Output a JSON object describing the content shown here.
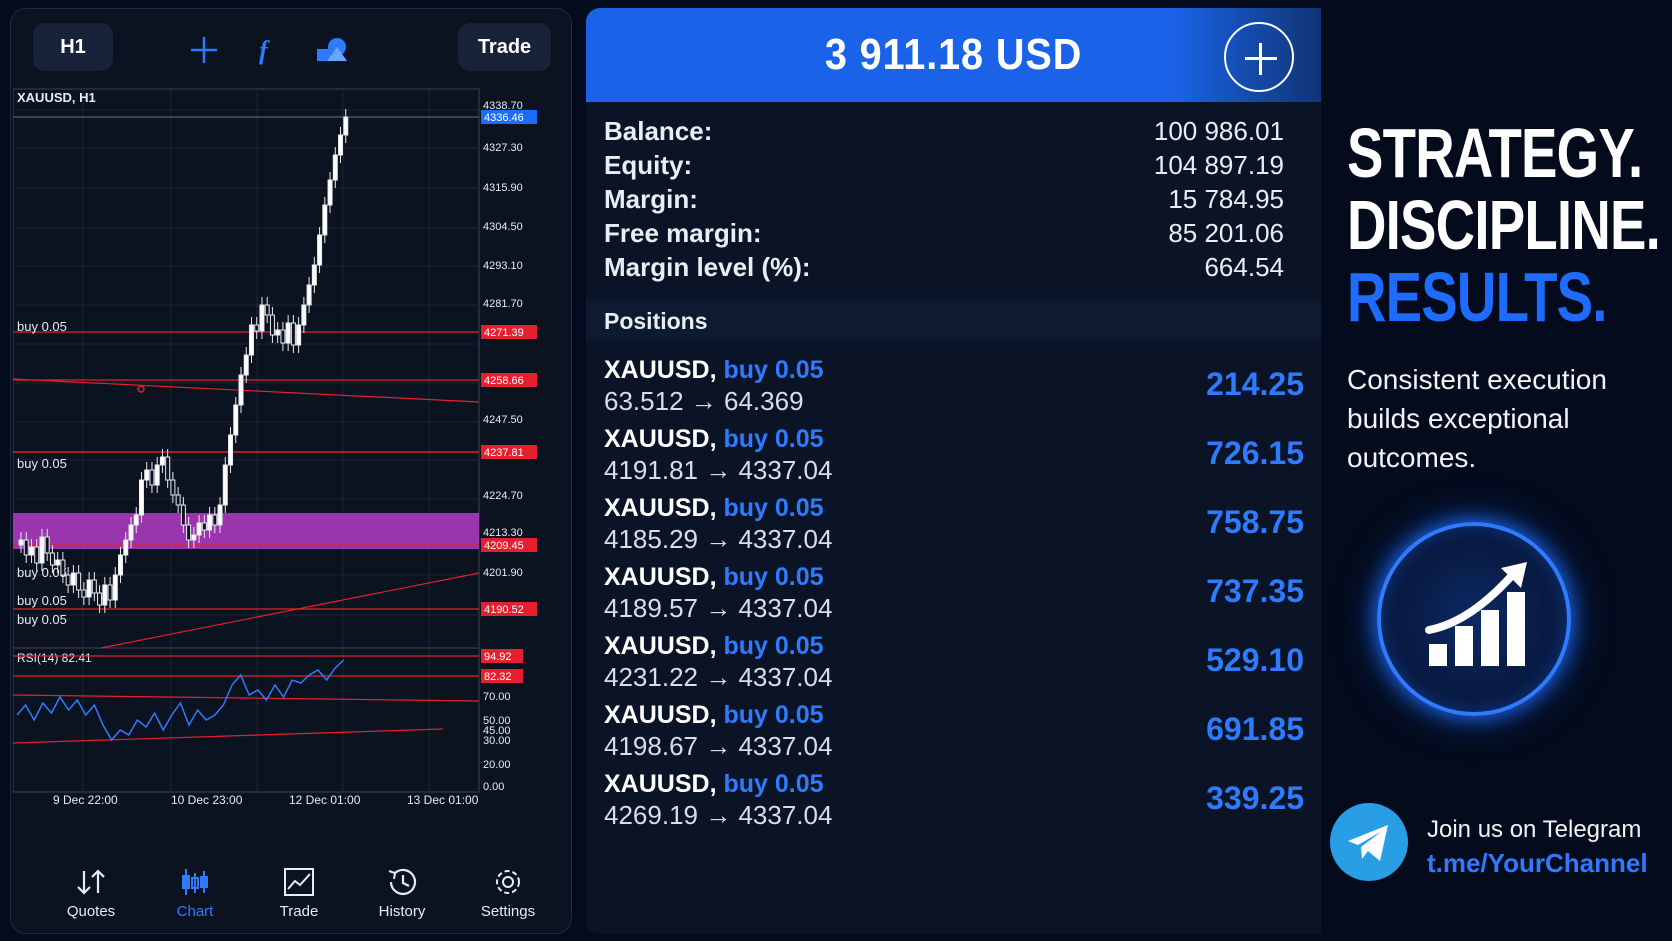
{
  "toolbar": {
    "timeframe": "H1",
    "trade_label": "Trade",
    "icons": [
      "crosshair-icon",
      "function-icon",
      "objects-icon"
    ]
  },
  "chart": {
    "symbol_label": "XAUUSD, H1",
    "price_ticks": [
      "4338.70",
      "4327.30",
      "4315.90",
      "4304.50",
      "4293.10",
      "4281.70",
      "4247.50",
      "4224.70",
      "4213.30",
      "4201.90"
    ],
    "current_price": "4336.46",
    "level_tags": [
      "4271.39",
      "4258.66",
      "4237.81",
      "4209.45",
      "4190.52"
    ],
    "order_labels": [
      "buy 0.05",
      "buy 0.05",
      "buy 0.05",
      "buy 0.05",
      "buy 0.05"
    ],
    "rsi_label": "RSI(14) 82.41",
    "rsi_tags": [
      "94.92",
      "82.32"
    ],
    "rsi_ticks": [
      "70.00",
      "50.00",
      "45.00",
      "30.00",
      "20.00",
      "0.00"
    ],
    "time_ticks": [
      "9 Dec 22:00",
      "10 Dec 23:00",
      "12 Dec 01:00",
      "13 Dec 01:00"
    ],
    "colors": {
      "up_candle": "#ffffff",
      "level_line": "#e5202e",
      "zone": "#b43cc8",
      "rsi_line": "#2f7bff",
      "price_tag": "#1d6bff"
    }
  },
  "nav": [
    {
      "label": "Quotes",
      "icon": "quotes-icon",
      "active": false
    },
    {
      "label": "Chart",
      "icon": "chart-icon",
      "active": true
    },
    {
      "label": "Trade",
      "icon": "trade-icon",
      "active": false
    },
    {
      "label": "History",
      "icon": "history-icon",
      "active": false
    },
    {
      "label": "Settings",
      "icon": "settings-icon",
      "active": false
    }
  ],
  "account": {
    "amount": "3 911.18 USD",
    "summary": [
      {
        "label": "Balance:",
        "value": "100 986.01"
      },
      {
        "label": "Equity:",
        "value": "104 897.19"
      },
      {
        "label": "Margin:",
        "value": "15 784.95"
      },
      {
        "label": "Free margin:",
        "value": "85 201.06"
      },
      {
        "label": "Margin level (%):",
        "value": "664.54"
      }
    ],
    "positions_title": "Positions",
    "positions": [
      {
        "symbol": "XAUUSD,",
        "type": "buy 0.05",
        "open": "63.512",
        "arrow": "→",
        "current": "64.369",
        "profit": "214.25"
      },
      {
        "symbol": "XAUUSD,",
        "type": "buy 0.05",
        "open": "4191.81",
        "arrow": "→",
        "current": "4337.04",
        "profit": "726.15"
      },
      {
        "symbol": "XAUUSD,",
        "type": "buy 0.05",
        "open": "4185.29",
        "arrow": "→",
        "current": "4337.04",
        "profit": "758.75"
      },
      {
        "symbol": "XAUUSD,",
        "type": "buy 0.05",
        "open": "4189.57",
        "arrow": "→",
        "current": "4337.04",
        "profit": "737.35"
      },
      {
        "symbol": "XAUUSD,",
        "type": "buy 0.05",
        "open": "4231.22",
        "arrow": "→",
        "current": "4337.04",
        "profit": "529.10"
      },
      {
        "symbol": "XAUUSD,",
        "type": "buy 0.05",
        "open": "4198.67",
        "arrow": "→",
        "current": "4337.04",
        "profit": "691.85"
      },
      {
        "symbol": "XAUUSD,",
        "type": "buy 0.05",
        "open": "4269.19",
        "arrow": "→",
        "current": "4337.04",
        "profit": "339.25"
      }
    ]
  },
  "promo": {
    "headline": [
      "STRATEGY.",
      "DISCIPLINE.",
      "RESULTS."
    ],
    "tagline": "Consistent execution builds exceptional outcomes.",
    "telegram_line1": "Join us on Telegram",
    "telegram_line2": "t.me/YourChannel",
    "accent": "#1d6bff"
  }
}
